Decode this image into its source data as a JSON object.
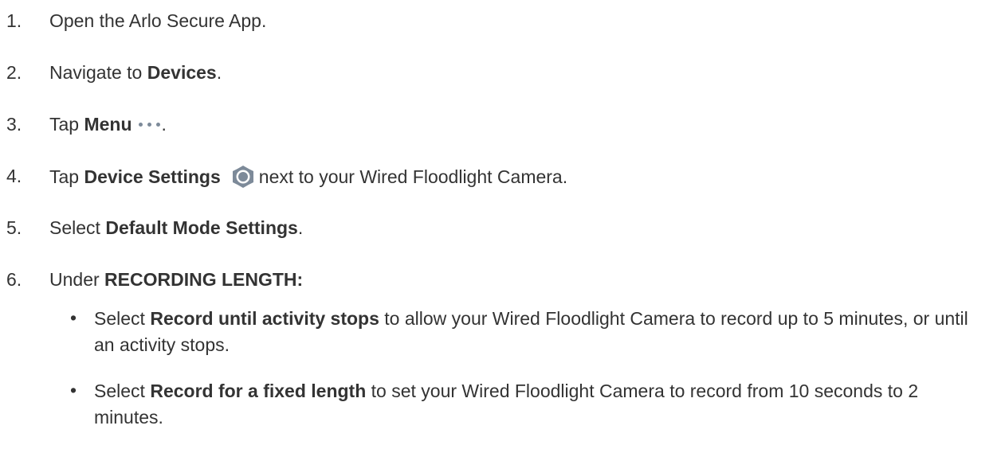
{
  "steps": [
    {
      "num": "1.",
      "pre": "Open the Arlo Secure App.",
      "bold": "",
      "post": ""
    },
    {
      "num": "2.",
      "pre": "Navigate to ",
      "bold": "Devices",
      "post": "."
    },
    {
      "num": "3.",
      "pre": "Tap ",
      "bold": "Menu",
      "post": "."
    },
    {
      "num": "4.",
      "pre": "Tap ",
      "bold": "Device Settings",
      "post": "next to your Wired Floodlight Camera."
    },
    {
      "num": "5.",
      "pre": "Select ",
      "bold": "Default Mode Settings",
      "post": "."
    },
    {
      "num": "6.",
      "pre": "Under ",
      "bold": "RECORDING LENGTH:",
      "post": ""
    }
  ],
  "substeps": [
    {
      "bullet": "•",
      "pre": "Select ",
      "bold": "Record until activity stops",
      "post": " to allow your Wired Floodlight Camera to record up to 5 minutes, or until an activity stops."
    },
    {
      "bullet": "•",
      "pre": "Select ",
      "bold": "Record for a fixed length",
      "post": " to set your Wired Floodlight Camera to record from 10 seconds to 2 minutes."
    }
  ],
  "icons": {
    "menu": "more-horizontal-icon",
    "settings": "gear-icon",
    "icon_color": "#7d8a99"
  }
}
